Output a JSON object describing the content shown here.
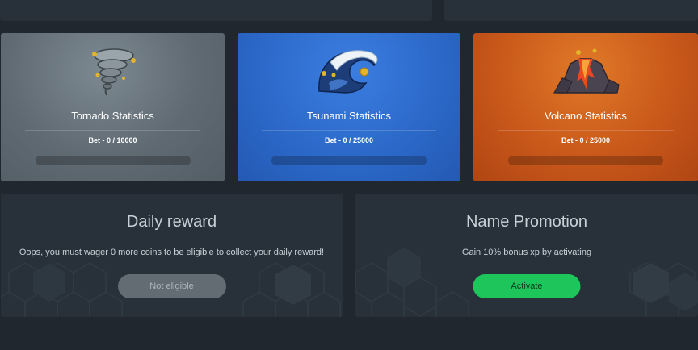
{
  "stats": [
    {
      "title": "Tornado Statistics",
      "bet": "Bet - 0 / 10000",
      "progress": 0
    },
    {
      "title": "Tsunami Statistics",
      "bet": "Bet - 0 / 25000",
      "progress": 0
    },
    {
      "title": "Volcano Statistics",
      "bet": "Bet - 0 / 25000",
      "progress": 0
    }
  ],
  "daily_reward": {
    "title": "Daily reward",
    "message": "Oops, you must wager 0 more coins to be eligible to collect your daily reward!",
    "button_label": "Not eligible"
  },
  "name_promotion": {
    "title": "Name Promotion",
    "message": "Gain 10% bonus xp by activating",
    "button_label": "Activate"
  },
  "icons": {
    "tornado": "tornado-icon",
    "tsunami": "tsunami-wave-icon",
    "volcano": "volcano-icon"
  },
  "colors": {
    "background": "#20272e",
    "panel": "#283139",
    "tornado_card": "#606b73",
    "tsunami_card": "#2c69c9",
    "volcano_card": "#c9581a",
    "activate_button": "#1ec55b",
    "disabled_button": "#636c73"
  }
}
